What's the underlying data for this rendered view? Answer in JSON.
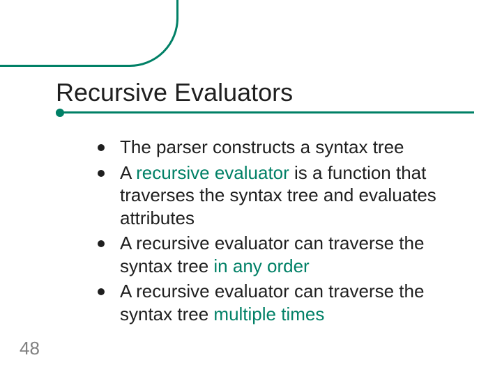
{
  "colors": {
    "accent": "#008066",
    "text": "#1f1f1f",
    "muted": "#808080"
  },
  "title": "Recursive Evaluators",
  "page_number": "48",
  "bullets": {
    "b1_pre": "The parser constructs a syntax tree",
    "b2_pre": "A ",
    "b2_em": "recursive evaluator",
    "b2_post": " is a function that traverses the syntax tree and evaluates attributes",
    "b3_pre": "A recursive evaluator can traverse the syntax tree ",
    "b3_em": "in any order",
    "b4_pre": "A recursive evaluator can traverse the syntax tree ",
    "b4_em": "multiple times"
  }
}
